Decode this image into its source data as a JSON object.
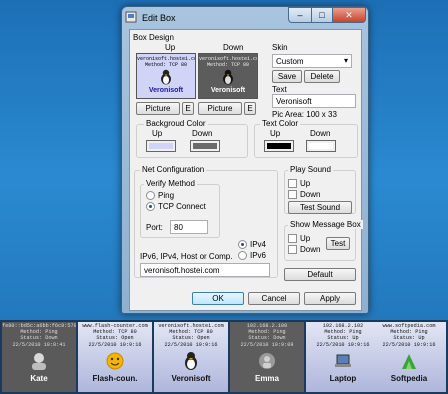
{
  "window": {
    "title": "Edit Box",
    "min_glyph": "–",
    "max_glyph": "□",
    "close_glyph": "✕"
  },
  "box_design": {
    "label": "Box Design",
    "up_label": "Up",
    "down_label": "Down",
    "preview_up": {
      "host": "veronisoft.hostei.com",
      "method": "Method: TCP 80",
      "name": "Veronisoft",
      "bg": "#d0d4f6"
    },
    "preview_down": {
      "host": "veronisoft.hostei.com",
      "method": "Method: TCP 80",
      "name": "Veronisoft",
      "bg": "#5c5c5c"
    },
    "picture_label": "Picture",
    "e_label": "E"
  },
  "skin": {
    "label": "Skin",
    "value": "Custom",
    "save_label": "Save",
    "delete_label": "Delete"
  },
  "text": {
    "label": "Text",
    "value": "Veronisoft",
    "pic_area": "Pic Area: 100 x 33"
  },
  "background_color": {
    "label": "Backgroud Color",
    "up_label": "Up",
    "down_label": "Down",
    "up_color": "#d0d4f6",
    "down_color": "#6a6a6a"
  },
  "text_color": {
    "label": "Text Color",
    "up_label": "Up",
    "down_label": "Down",
    "up_color": "#000000",
    "down_color": "#ffffff"
  },
  "net_config": {
    "label": "Net Configuration",
    "verify_label": "Verify Method",
    "ping_label": "Ping",
    "tcp_label": "TCP Connect",
    "port_label": "Port:",
    "port_value": "80",
    "ipv4_label": "IPv4",
    "ipv6_label": "IPv6",
    "host_label": "IPv6, IPv4, Host or Comp.",
    "host_value": "veronisoft.hostei.com"
  },
  "play_sound": {
    "label": "Play Sound",
    "up_label": "Up",
    "down_label": "Down",
    "test_label": "Test Sound"
  },
  "message_box": {
    "label": "Show Message Box",
    "up_label": "Up",
    "down_label": "Down",
    "test_label": "Test"
  },
  "buttons": {
    "default": "Default",
    "ok": "OK",
    "cancel": "Cancel",
    "apply": "Apply"
  },
  "tiles": [
    {
      "info1": "fe80::bd5c:a6bb:f6c9:579",
      "info2": "Method: Ping",
      "info3": "Status: Down",
      "info4": "22/5/2010 10:8:41",
      "name": "Kate",
      "icon": "kate-icon"
    },
    {
      "info1": "www.flash-counter.com",
      "info2": "Method: TCP 80",
      "info3": "Status: Open",
      "info4": "22/5/2010 10:9:16",
      "name": "Flash-coun.",
      "icon": "smiley-icon"
    },
    {
      "info1": "veronisoft.hostei.com",
      "info2": "Method: TCP 80",
      "info3": "Status: Open",
      "info4": "22/5/2010 10:9:16",
      "name": "Veronisoft",
      "icon": "tux-icon"
    },
    {
      "info1": "192.168.2.100",
      "info2": "Method: Ping",
      "info3": "Status: Down",
      "info4": "22/5/2010 10:9:09",
      "name": "Emma",
      "icon": "emma-icon"
    },
    {
      "info1": "192.168.2.102",
      "info2": "Method: Ping",
      "info3": "Status: Up",
      "info4": "22/5/2010 10:9:16",
      "name": "Laptop",
      "icon": "laptop-icon"
    },
    {
      "info1": "www.softpedia.com",
      "info2": "Method: Ping",
      "info3": "Status: Up",
      "info4": "22/5/2010 10:9:16",
      "name": "Softpedia",
      "icon": "softpedia-icon"
    }
  ]
}
